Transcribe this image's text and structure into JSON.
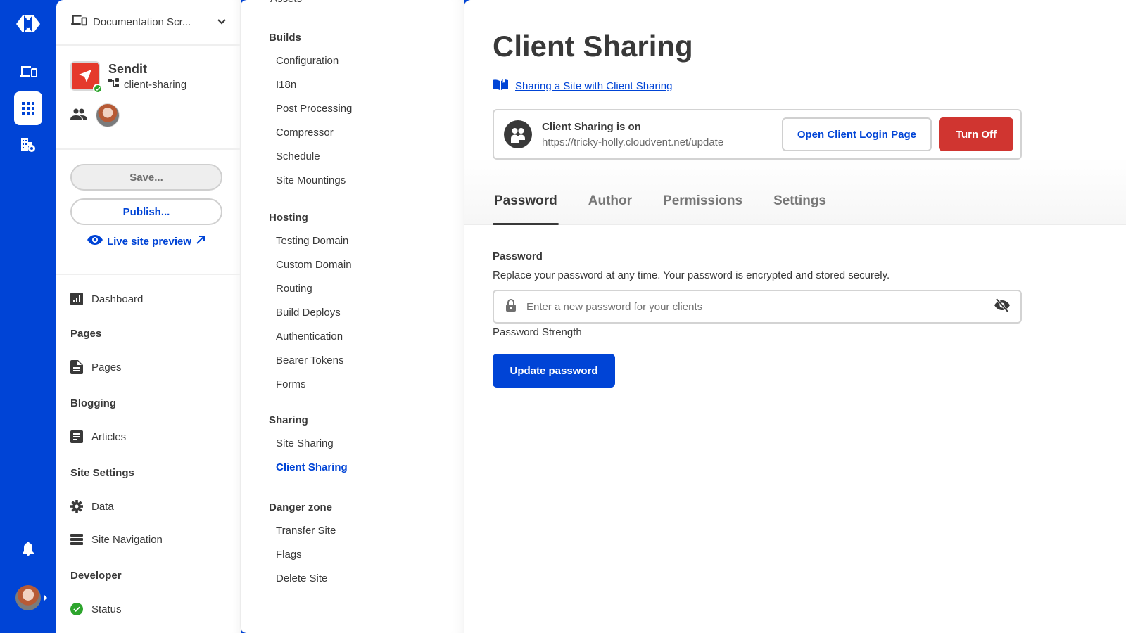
{
  "colors": {
    "brand_blue": "#0044d6",
    "danger_red": "#d03530",
    "success_green": "#2da52d",
    "site_logo_red": "#e53a2c",
    "text_dark": "#393939"
  },
  "rail": {
    "icons": [
      "cloudvent-logo-icon",
      "devices-icon",
      "apps-grid-icon",
      "building-settings-icon",
      "bell-icon"
    ],
    "active": "apps-grid-icon"
  },
  "project": {
    "name": "Documentation Scr..."
  },
  "site": {
    "name": "Sendit",
    "branch": "client-sharing",
    "status": "ok"
  },
  "actions": {
    "save_label": "Save...",
    "publish_label": "Publish...",
    "preview_label": "Live site preview"
  },
  "sidebar": {
    "dashboard": "Dashboard",
    "sections": [
      {
        "heading": "Pages",
        "items": [
          {
            "label": "Pages",
            "icon": "file-text-icon"
          }
        ]
      },
      {
        "heading": "Blogging",
        "items": [
          {
            "label": "Articles",
            "icon": "article-icon"
          }
        ]
      },
      {
        "heading": "Site Settings",
        "items": [
          {
            "label": "Data",
            "icon": "gear-icon"
          },
          {
            "label": "Site Navigation",
            "icon": "menu-bars-icon"
          }
        ]
      },
      {
        "heading": "Developer",
        "items": [
          {
            "label": "Status",
            "icon": "check-circle-icon"
          }
        ]
      }
    ]
  },
  "settings_nav": {
    "cut_off_item": "Assets",
    "sections": [
      {
        "heading": "Builds",
        "items": [
          "Configuration",
          "I18n",
          "Post Processing",
          "Compressor",
          "Schedule",
          "Site Mountings"
        ]
      },
      {
        "heading": "Hosting",
        "items": [
          "Testing Domain",
          "Custom Domain",
          "Routing",
          "Build Deploys",
          "Authentication",
          "Bearer Tokens",
          "Forms"
        ]
      },
      {
        "heading": "Sharing",
        "items": [
          "Site Sharing",
          "Client Sharing"
        ]
      },
      {
        "heading": "Danger zone",
        "items": [
          "Transfer Site",
          "Flags",
          "Delete Site"
        ]
      }
    ],
    "active_item": "Client Sharing"
  },
  "main": {
    "title": "Client Sharing",
    "doc_link": "Sharing a Site with Client Sharing",
    "status": {
      "title": "Client Sharing is on",
      "url": "https://tricky-holly.cloudvent.net/update",
      "open_button": "Open Client Login Page",
      "turn_off_button": "Turn Off"
    },
    "tabs": [
      {
        "label": "Password",
        "active": true
      },
      {
        "label": "Author",
        "active": false
      },
      {
        "label": "Permissions",
        "active": false
      },
      {
        "label": "Settings",
        "active": false
      }
    ],
    "password": {
      "label": "Password",
      "help": "Replace your password at any time. Your password is encrypted and stored securely.",
      "placeholder": "Enter a new password for your clients",
      "value": "",
      "strength_label": "Password Strength",
      "submit": "Update password"
    }
  }
}
